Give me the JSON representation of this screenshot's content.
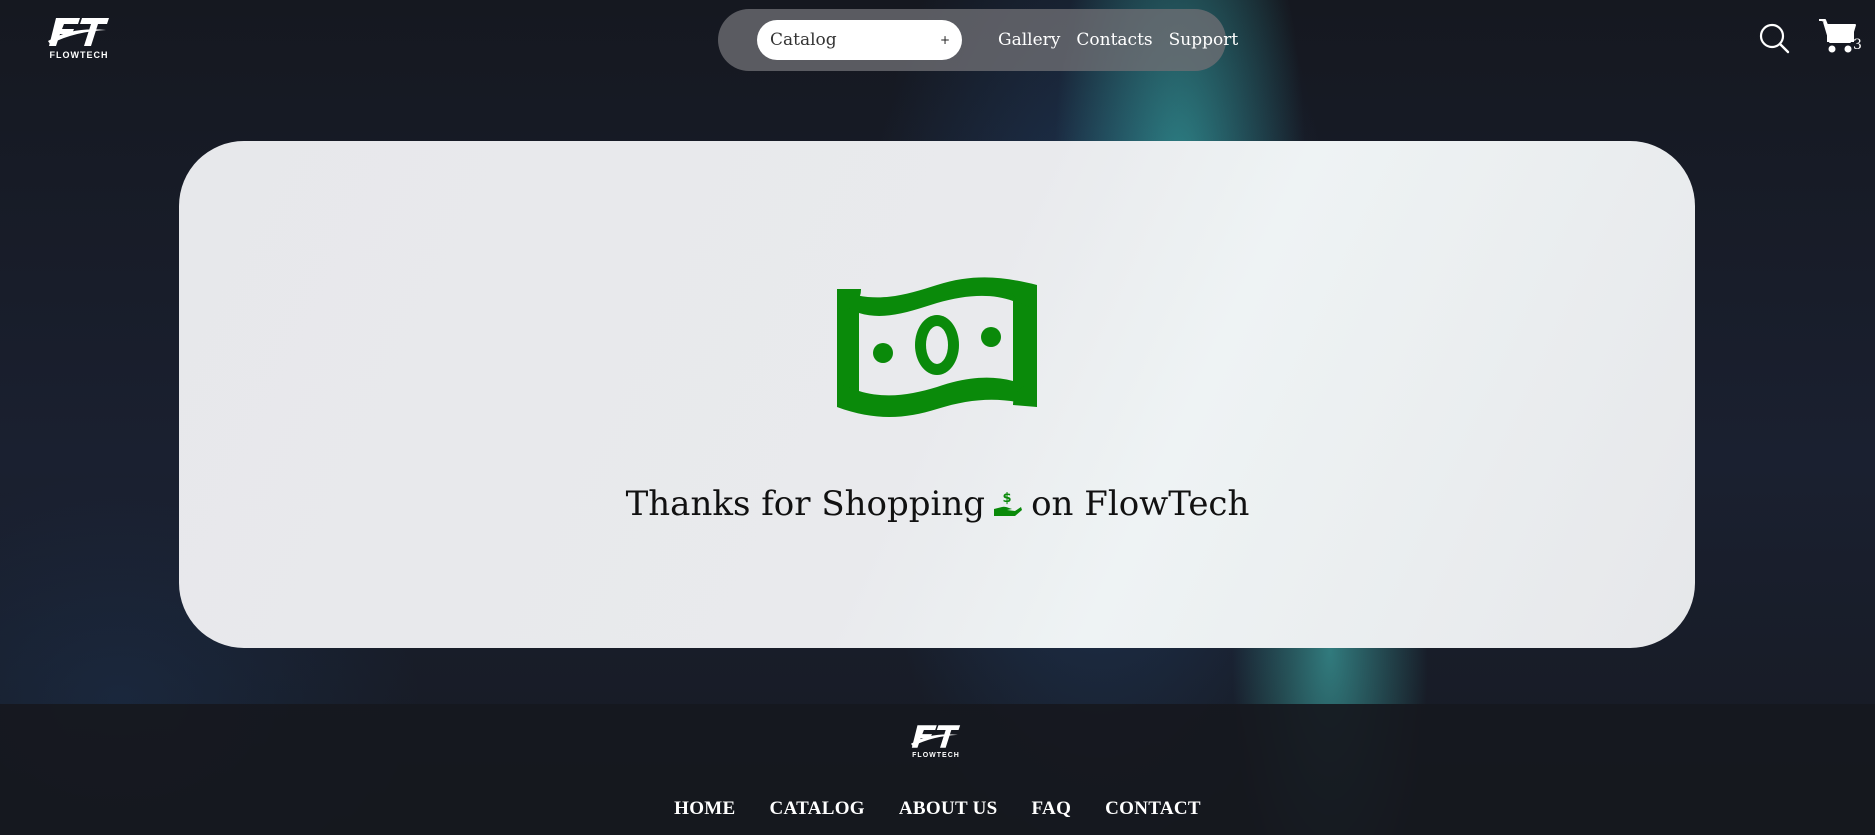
{
  "brand": {
    "name": "FLOWTECH",
    "accent_color": "#0a8a0a"
  },
  "header": {
    "catalog_select": {
      "value": "Catalog",
      "expand_glyph": "+"
    },
    "nav_links": [
      "Gallery",
      "Contacts",
      "Support"
    ],
    "search_icon": "search-icon",
    "cart": {
      "icon": "cart-icon",
      "count": "3"
    }
  },
  "main": {
    "icon": "money-bill-icon",
    "message_before": "Thanks for Shopping",
    "message_icon": "hand-holding-dollar-icon",
    "message_after": "on FlowTech"
  },
  "footer": {
    "links": [
      "HOME",
      "CATALOG",
      "ABOUT US",
      "FAQ",
      "CONTACT"
    ]
  }
}
